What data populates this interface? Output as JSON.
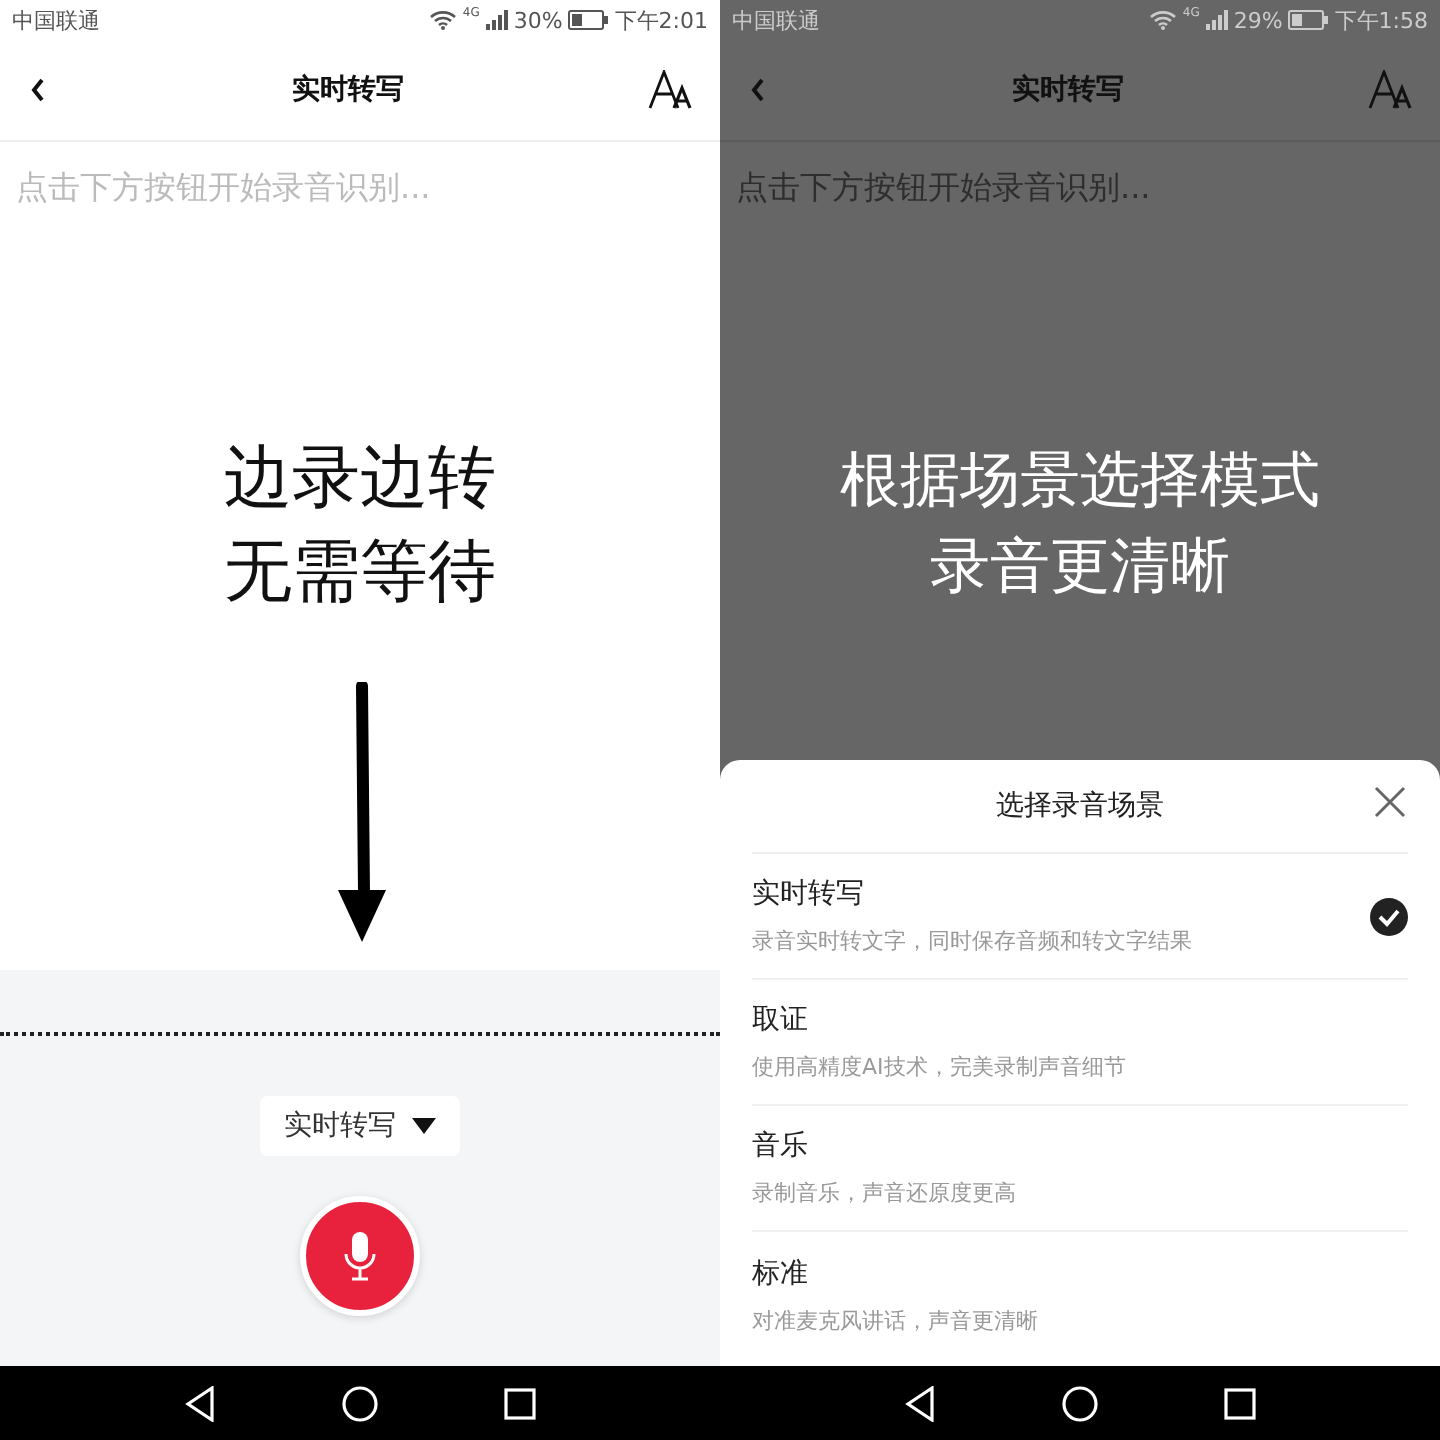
{
  "screens": [
    {
      "dimmed": false,
      "status_bar": {
        "carrier": "中国联通",
        "network": "4G",
        "battery": "30%",
        "time": "下午2:01"
      },
      "header": {
        "title": "实时转写"
      },
      "transcript": {
        "placeholder": "点击下方按钮开始录音识别..."
      },
      "caption": [
        "边录边转",
        "无需等待"
      ],
      "arrow": true,
      "recorder": {
        "mode": "实时转写"
      }
    },
    {
      "dimmed": true,
      "status_bar": {
        "carrier": "中国联通",
        "network": "4G",
        "battery": "29%",
        "time": "下午1:58"
      },
      "header": {
        "title": "实时转写"
      },
      "transcript": {
        "placeholder": "点击下方按钮开始录音识别..."
      },
      "caption": [
        "根据场景选择模式",
        "录音更清晰"
      ],
      "arrow": false,
      "sheet": {
        "title": "选择录音场景",
        "options": [
          {
            "name": "实时转写",
            "description": "录音实时转文字，同时保存音频和转文字结果",
            "selected": true
          },
          {
            "name": "取证",
            "description": "使用高精度AI技术，完美录制声音细节",
            "selected": false
          },
          {
            "name": "音乐",
            "description": "录制音乐，声音还原度更高",
            "selected": false
          },
          {
            "name": "标准",
            "description": "对准麦克风讲话，声音更清晰",
            "selected": false
          }
        ]
      }
    }
  ]
}
